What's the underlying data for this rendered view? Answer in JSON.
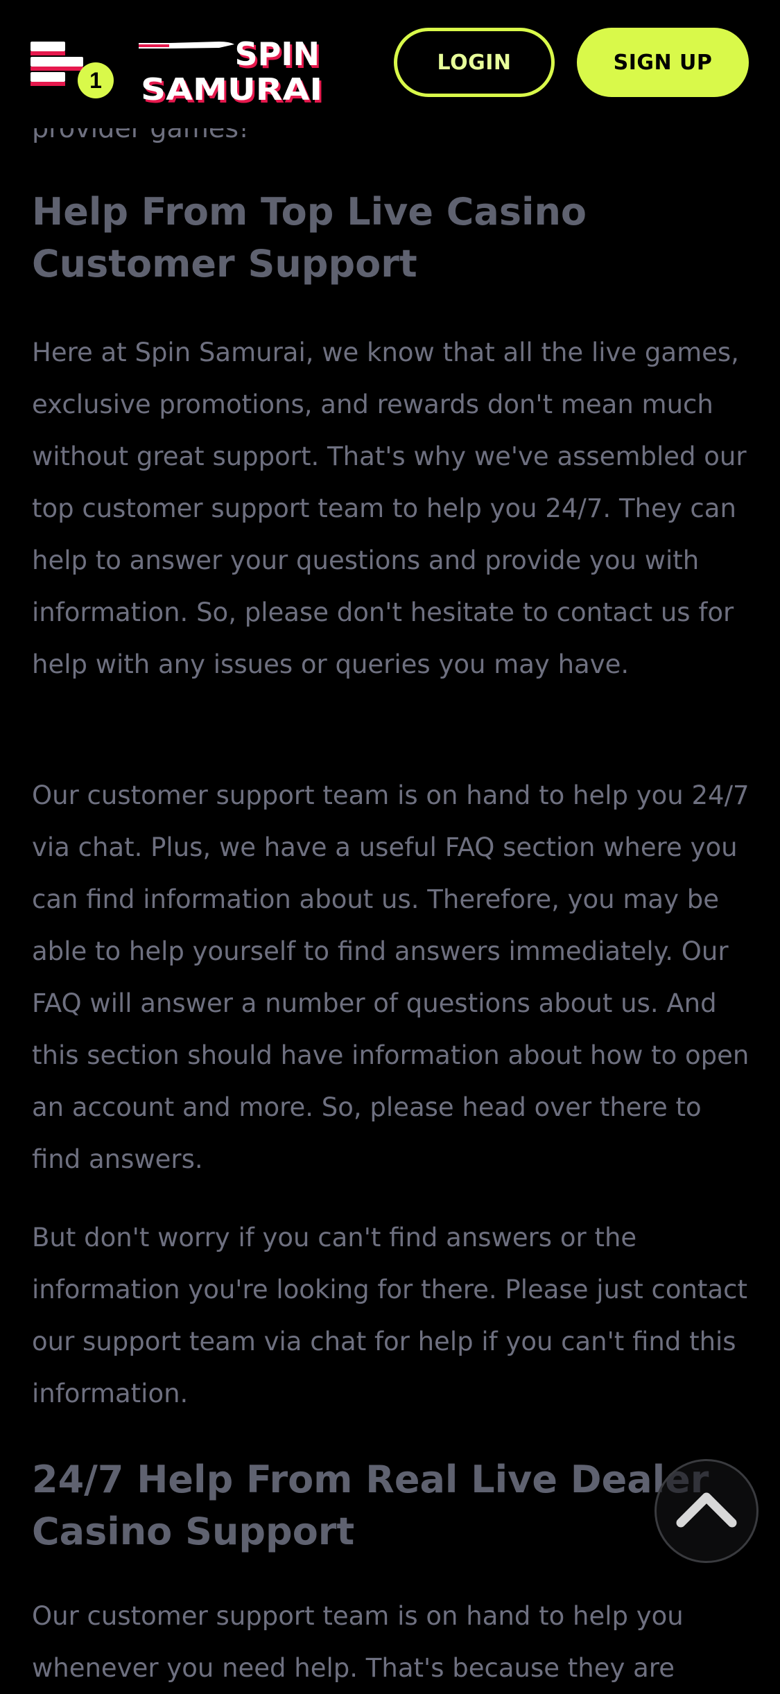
{
  "header": {
    "menu_badge_count": "1",
    "logo_line1": "SPIN",
    "logo_line2": "SAMURAI",
    "login_label": "LOGIN",
    "signup_label": "SIGN UP"
  },
  "article": {
    "partial_line": "provider games!",
    "heading1": "Help From Top Live Casino Customer Support",
    "paragraphs": [
      "Here at Spin Samurai, we know that all the live games, exclusive promotions, and rewards don't mean much without great support. That's why we've assembled our top customer support team to help you 24/7. They can help to answer your questions and provide you with information. So, please don't hesitate to contact us for help with any issues or queries you may have.",
      "Our customer support team is on hand to help you 24/7 via chat. Plus, we have a useful FAQ section where you can find information about us. Therefore, you may be able to help yourself to find answers immediately. Our FAQ will answer a number of questions about us. And this section should have information about how to open an account and more. So, please head over there to find answers.",
      "But don't worry if you can't find answers or the information you're looking for there. Please just contact our support team via chat for help if you can't find this information."
    ],
    "heading2": "24/7 Help From Real Live Dealer Casino Support",
    "paragraph4": "Our customer support team is on hand to help you whenever you need help. That's because they are"
  },
  "colors": {
    "background": "#000000",
    "accent": "#d9f94a",
    "logo_red": "#e5194d",
    "body_text": "#6e7080",
    "heading_text": "#5f6270"
  },
  "icons": {
    "menu": "hamburger-menu-icon",
    "scroll_top": "chevron-up-icon"
  }
}
